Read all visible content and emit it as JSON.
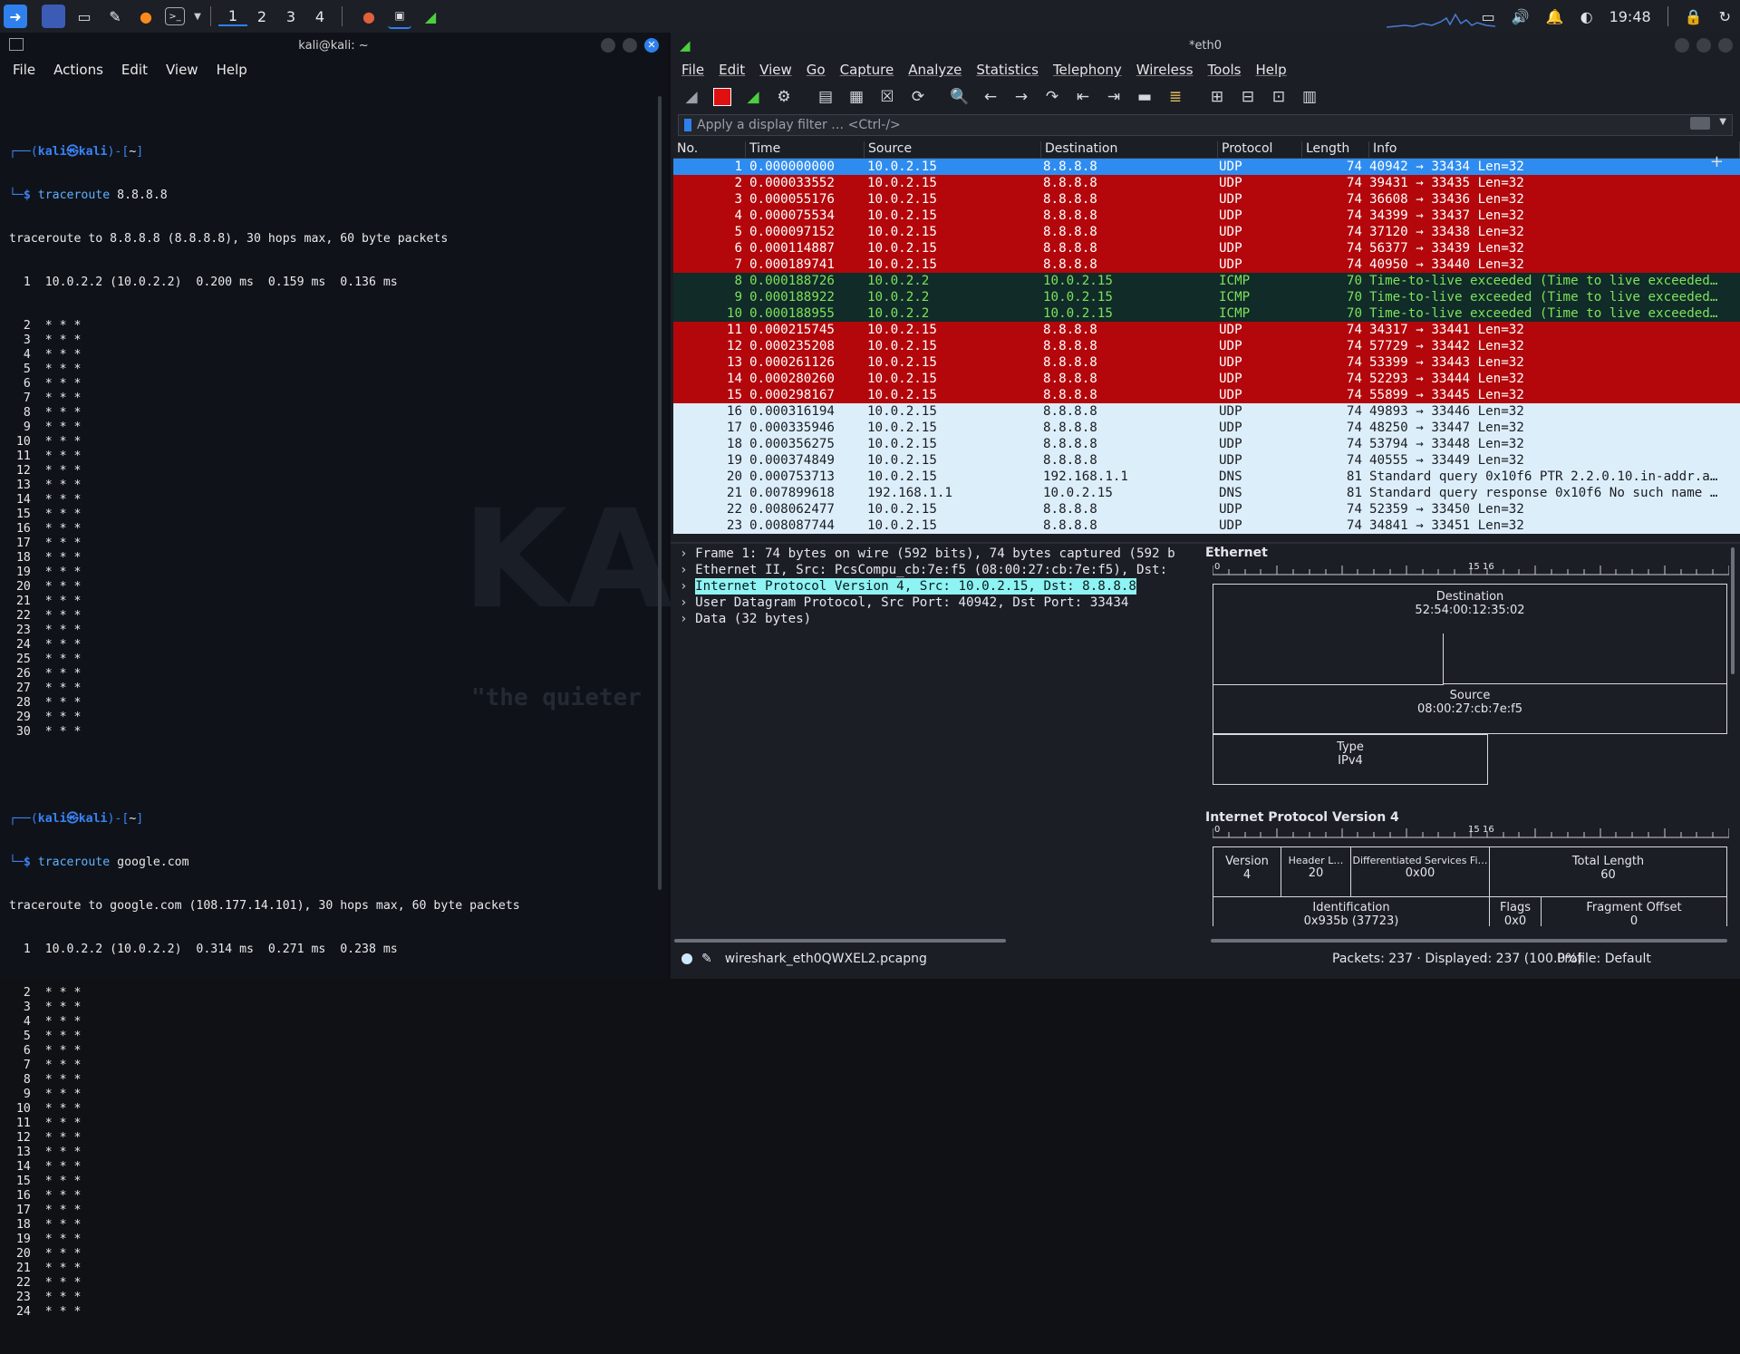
{
  "taskbar": {
    "workspaces": [
      "1",
      "2",
      "3",
      "4"
    ],
    "clock": "19:48"
  },
  "terminal": {
    "title": "kali@kali: ~",
    "menu": [
      "File",
      "Actions",
      "Edit",
      "View",
      "Help"
    ],
    "watermark_line": "\"the quieter",
    "session1": {
      "prompt_user": "kali",
      "prompt_host": "kali",
      "prompt_dir": "~",
      "command": "traceroute",
      "arg": "8.8.8.8",
      "header": "traceroute to 8.8.8.8 (8.8.8.8), 30 hops max, 60 byte packets",
      "hop1": "  1  10.0.2.2 (10.0.2.2)  0.200 ms  0.159 ms  0.136 ms",
      "stars_from": 2,
      "stars_to": 30
    },
    "session2": {
      "prompt_user": "kali",
      "prompt_host": "kali",
      "prompt_dir": "~",
      "command": "traceroute",
      "arg": "google.com",
      "header": "traceroute to google.com (108.177.14.101), 30 hops max, 60 byte packets",
      "hop1": "  1  10.0.2.2 (10.0.2.2)  0.314 ms  0.271 ms  0.238 ms",
      "stars_from": 2,
      "stars_to": 24
    }
  },
  "wireshark": {
    "title": "*eth0",
    "menu": [
      "File",
      "Edit",
      "View",
      "Go",
      "Capture",
      "Analyze",
      "Statistics",
      "Telephony",
      "Wireless",
      "Tools",
      "Help"
    ],
    "filter_placeholder": "Apply a display filter … <Ctrl-/>",
    "columns": [
      "No.",
      "Time",
      "Source",
      "Destination",
      "Protocol",
      "Length",
      "Info"
    ],
    "packets": [
      {
        "no": "1",
        "time": "0.000000000",
        "src": "10.0.2.15",
        "dst": "8.8.8.8",
        "proto": "UDP",
        "len": "74",
        "info": "40942 → 33434 Len=32",
        "style": "sel"
      },
      {
        "no": "2",
        "time": "0.000033552",
        "src": "10.0.2.15",
        "dst": "8.8.8.8",
        "proto": "UDP",
        "len": "74",
        "info": "39431 → 33435 Len=32",
        "style": "red"
      },
      {
        "no": "3",
        "time": "0.000055176",
        "src": "10.0.2.15",
        "dst": "8.8.8.8",
        "proto": "UDP",
        "len": "74",
        "info": "36608 → 33436 Len=32",
        "style": "red"
      },
      {
        "no": "4",
        "time": "0.000075534",
        "src": "10.0.2.15",
        "dst": "8.8.8.8",
        "proto": "UDP",
        "len": "74",
        "info": "34399 → 33437 Len=32",
        "style": "red"
      },
      {
        "no": "5",
        "time": "0.000097152",
        "src": "10.0.2.15",
        "dst": "8.8.8.8",
        "proto": "UDP",
        "len": "74",
        "info": "37120 → 33438 Len=32",
        "style": "red"
      },
      {
        "no": "6",
        "time": "0.000114887",
        "src": "10.0.2.15",
        "dst": "8.8.8.8",
        "proto": "UDP",
        "len": "74",
        "info": "56377 → 33439 Len=32",
        "style": "red"
      },
      {
        "no": "7",
        "time": "0.000189741",
        "src": "10.0.2.15",
        "dst": "8.8.8.8",
        "proto": "UDP",
        "len": "74",
        "info": "40950 → 33440 Len=32",
        "style": "red"
      },
      {
        "no": "8",
        "time": "0.000188726",
        "src": "10.0.2.2",
        "dst": "10.0.2.15",
        "proto": "ICMP",
        "len": "70",
        "info": "Time-to-live exceeded (Time to live exceeded…",
        "style": "icmp"
      },
      {
        "no": "9",
        "time": "0.000188922",
        "src": "10.0.2.2",
        "dst": "10.0.2.15",
        "proto": "ICMP",
        "len": "70",
        "info": "Time-to-live exceeded (Time to live exceeded…",
        "style": "icmp"
      },
      {
        "no": "10",
        "time": "0.000188955",
        "src": "10.0.2.2",
        "dst": "10.0.2.15",
        "proto": "ICMP",
        "len": "70",
        "info": "Time-to-live exceeded (Time to live exceeded…",
        "style": "icmp"
      },
      {
        "no": "11",
        "time": "0.000215745",
        "src": "10.0.2.15",
        "dst": "8.8.8.8",
        "proto": "UDP",
        "len": "74",
        "info": "34317 → 33441 Len=32",
        "style": "red"
      },
      {
        "no": "12",
        "time": "0.000235208",
        "src": "10.0.2.15",
        "dst": "8.8.8.8",
        "proto": "UDP",
        "len": "74",
        "info": "57729 → 33442 Len=32",
        "style": "red"
      },
      {
        "no": "13",
        "time": "0.000261126",
        "src": "10.0.2.15",
        "dst": "8.8.8.8",
        "proto": "UDP",
        "len": "74",
        "info": "53399 → 33443 Len=32",
        "style": "red"
      },
      {
        "no": "14",
        "time": "0.000280260",
        "src": "10.0.2.15",
        "dst": "8.8.8.8",
        "proto": "UDP",
        "len": "74",
        "info": "52293 → 33444 Len=32",
        "style": "red"
      },
      {
        "no": "15",
        "time": "0.000298167",
        "src": "10.0.2.15",
        "dst": "8.8.8.8",
        "proto": "UDP",
        "len": "74",
        "info": "55899 → 33445 Len=32",
        "style": "red"
      },
      {
        "no": "16",
        "time": "0.000316194",
        "src": "10.0.2.15",
        "dst": "8.8.8.8",
        "proto": "UDP",
        "len": "74",
        "info": "49893 → 33446 Len=32",
        "style": "lb"
      },
      {
        "no": "17",
        "time": "0.000335946",
        "src": "10.0.2.15",
        "dst": "8.8.8.8",
        "proto": "UDP",
        "len": "74",
        "info": "48250 → 33447 Len=32",
        "style": "lb"
      },
      {
        "no": "18",
        "time": "0.000356275",
        "src": "10.0.2.15",
        "dst": "8.8.8.8",
        "proto": "UDP",
        "len": "74",
        "info": "53794 → 33448 Len=32",
        "style": "lb"
      },
      {
        "no": "19",
        "time": "0.000374849",
        "src": "10.0.2.15",
        "dst": "8.8.8.8",
        "proto": "UDP",
        "len": "74",
        "info": "40555 → 33449 Len=32",
        "style": "lb"
      },
      {
        "no": "20",
        "time": "0.000753713",
        "src": "10.0.2.15",
        "dst": "192.168.1.1",
        "proto": "DNS",
        "len": "81",
        "info": "Standard query 0x10f6 PTR 2.2.0.10.in-addr.a…",
        "style": "lb"
      },
      {
        "no": "21",
        "time": "0.007899618",
        "src": "192.168.1.1",
        "dst": "10.0.2.15",
        "proto": "DNS",
        "len": "81",
        "info": "Standard query response 0x10f6 No such name …",
        "style": "lb"
      },
      {
        "no": "22",
        "time": "0.008062477",
        "src": "10.0.2.15",
        "dst": "8.8.8.8",
        "proto": "UDP",
        "len": "74",
        "info": "52359 → 33450 Len=32",
        "style": "lb"
      },
      {
        "no": "23",
        "time": "0.008087744",
        "src": "10.0.2.15",
        "dst": "8.8.8.8",
        "proto": "UDP",
        "len": "74",
        "info": "34841 → 33451 Len=32",
        "style": "lb"
      }
    ],
    "details": [
      {
        "text": "Frame 1: 74 bytes on wire (592 bits), 74 bytes captured (592 b",
        "selected": false
      },
      {
        "text": "Ethernet II, Src: PcsCompu_cb:7e:f5 (08:00:27:cb:7e:f5), Dst: ",
        "selected": false
      },
      {
        "text": "Internet Protocol Version 4, Src: 10.0.2.15, Dst: 8.8.8.8",
        "selected": true
      },
      {
        "text": "User Datagram Protocol, Src Port: 40942, Dst Port: 33434",
        "selected": false
      },
      {
        "text": "Data (32 bytes)",
        "selected": false
      }
    ],
    "diagram": {
      "eth_title": "Ethernet",
      "ruler_start": "0",
      "ruler_15": "15",
      "ruler_16": "16",
      "dest_label": "Destination",
      "dest_value": "52:54:00:12:35:02",
      "src_label": "Source",
      "src_value": "08:00:27:cb:7e:f5",
      "type_label": "Type",
      "type_value": "IPv4",
      "ip_title": "Internet Protocol Version 4",
      "version_label": "Version",
      "version_value": "4",
      "hl_label": "Header L…",
      "hl_value": "20",
      "dsf_label": "Differentiated Services Fi…",
      "dsf_value": "0x00",
      "tl_label": "Total Length",
      "tl_value": "60",
      "id_label": "Identification",
      "id_value": "0x935b (37723)",
      "flags_label": "Flags",
      "flags_value": "0x0",
      "fo_label": "Fragment Offset",
      "fo_value": "0"
    },
    "status": {
      "file": "wireshark_eth0QWXEL2.pcapng",
      "packets": "Packets: 237 · Displayed: 237 (100.0%)",
      "profile": "Profile: Default"
    }
  }
}
